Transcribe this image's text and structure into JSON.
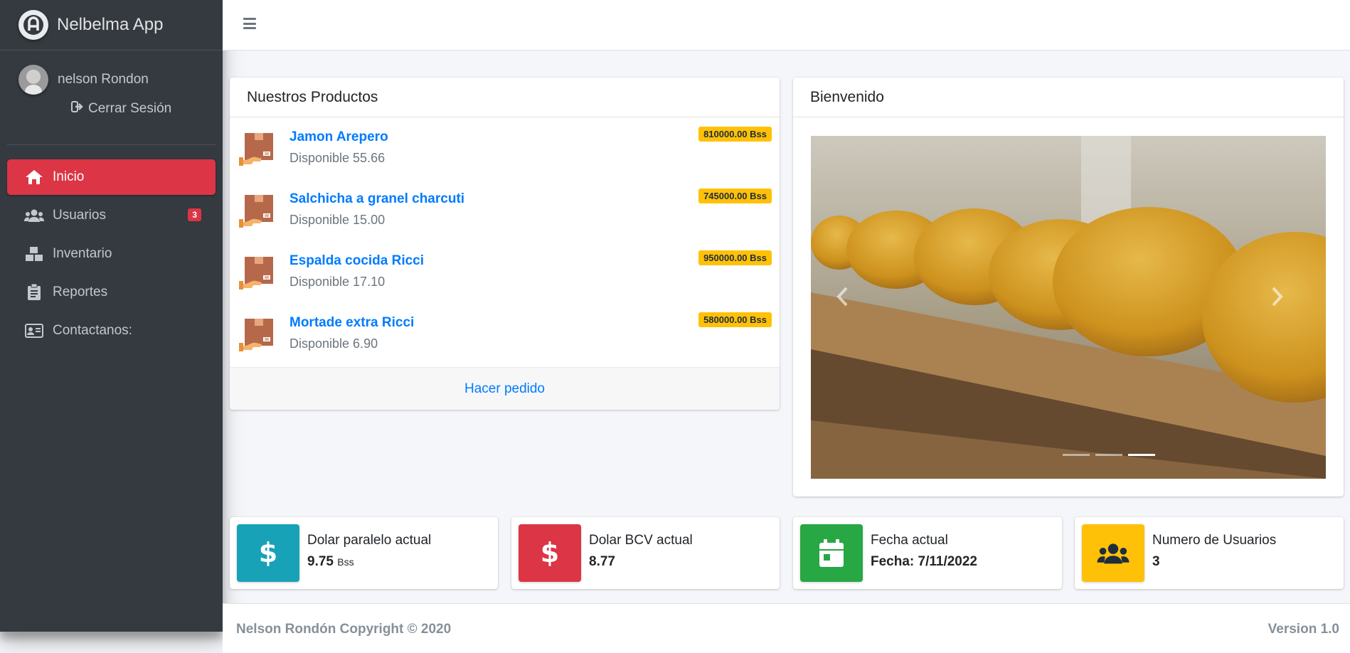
{
  "brand": {
    "title": "Nelbelma App"
  },
  "user": {
    "name": "nelson Rondon",
    "logout_label": "Cerrar Sesión"
  },
  "nav": {
    "items": [
      {
        "label": "Inicio",
        "icon": "home-icon",
        "active": true
      },
      {
        "label": "Usuarios",
        "icon": "users-icon",
        "badge": "3"
      },
      {
        "label": "Inventario",
        "icon": "boxes-icon"
      },
      {
        "label": "Reportes",
        "icon": "clipboard-icon"
      },
      {
        "label": "Contactanos:",
        "icon": "address-card-icon"
      }
    ]
  },
  "products": {
    "title": "Nuestros Productos",
    "items": [
      {
        "name": "Jamon Arepero",
        "desc": "Disponible 55.66",
        "price": "810000.00 Bss"
      },
      {
        "name": "Salchicha a granel charcuti",
        "desc": "Disponible 15.00",
        "price": "745000.00 Bss"
      },
      {
        "name": "Espalda cocida Ricci",
        "desc": "Disponible 17.10",
        "price": "950000.00 Bss"
      },
      {
        "name": "Mortade extra Ricci",
        "desc": "Disponible 6.90",
        "price": "580000.00 Bss"
      }
    ],
    "footer_link": "Hacer pedido"
  },
  "welcome": {
    "title": "Bienvenido",
    "carousel": {
      "slide_count": 3,
      "active_slide": 3
    }
  },
  "info_boxes": [
    {
      "label": "Dolar paralelo actual",
      "value": "9.75",
      "unit": "Bss",
      "color": "#17a2b8",
      "icon": "dollar-icon"
    },
    {
      "label": "Dolar BCV actual",
      "value": "8.77",
      "color": "#dc3545",
      "icon": "dollar-icon"
    },
    {
      "label": "Fecha actual",
      "value": "Fecha: 7/11/2022",
      "color": "#28a745",
      "icon": "calendar-icon"
    },
    {
      "label": "Numero de Usuarios",
      "value": "3",
      "color": "#ffc107",
      "icon": "users-icon"
    }
  ],
  "footer": {
    "copyright": "Nelson Rondón Copyright © 2020",
    "version": "Version 1.0"
  }
}
